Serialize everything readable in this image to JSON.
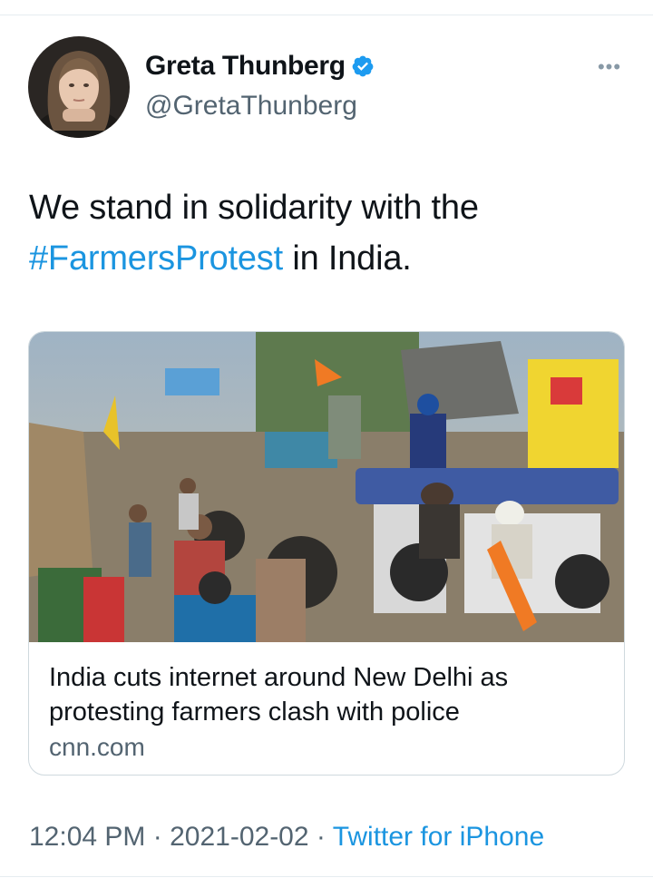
{
  "author": {
    "display_name": "Greta Thunberg",
    "handle": "@GretaThunberg",
    "verified": true,
    "avatar_icon": "profile-photo"
  },
  "menu": {
    "more_icon": "more-horizontal-icon",
    "label": "•••"
  },
  "tweet": {
    "text_before": "We stand in solidarity with the",
    "hashtag": "#FarmersProtest",
    "text_after": " in India."
  },
  "card": {
    "image_description_icon": "news-photo",
    "title": "India cuts internet around New Delhi as protesting farmers clash with police",
    "domain": "cnn.com"
  },
  "meta": {
    "time": "12:04 PM",
    "separator": " · ",
    "date": "2021-02-02",
    "source": "Twitter for iPhone"
  },
  "colors": {
    "link": "#1b95e0",
    "secondary_text": "#536471",
    "verified_badge": "#1d9bf0"
  }
}
